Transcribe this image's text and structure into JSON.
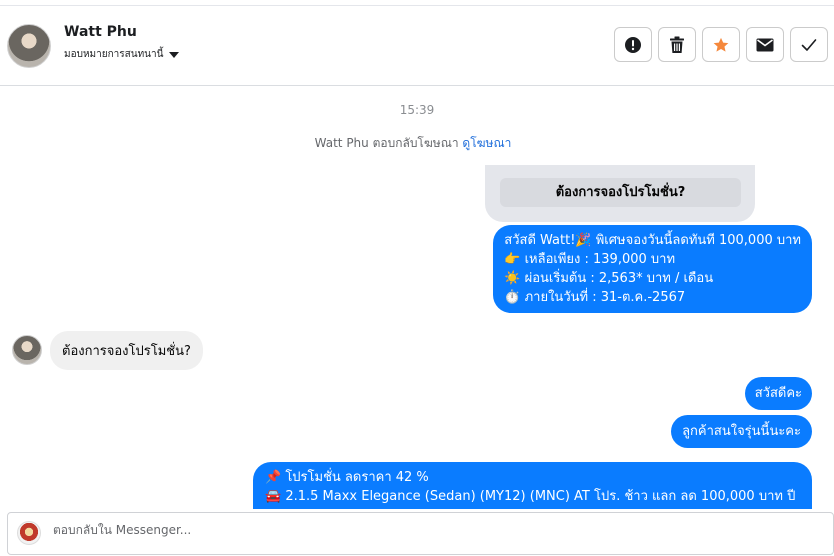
{
  "header": {
    "contact_name": "Watt Phu",
    "assign_label": "มอบหมายการสนทนานี้",
    "actions": [
      {
        "icon": "exclamation-icon",
        "color": "#1c1e21"
      },
      {
        "icon": "trash-icon",
        "color": "#1c1e21"
      },
      {
        "icon": "star-icon",
        "color": "#f5883c"
      },
      {
        "icon": "envelope-icon",
        "color": "#1c1e21"
      },
      {
        "icon": "checkmark-icon",
        "color": "#1c1e21"
      }
    ]
  },
  "conversation": {
    "timestamp": "15:39",
    "reply_note": "Watt Phu ตอบกลับโฆษณา",
    "view_ad_link": "ดูโฆษณา",
    "ad_button_label": "ต้องการจองโปรโมชั่น?",
    "greeting_lines": [
      "สวัสดี Watt!🎉 พิเศษจองวันนี้ลดทันที 100,000 บาท",
      "👉 เหลือเพียง : 139,000 บาท",
      "☀️ ผ่อนเริ่มต้น : 2,563* บาท / เดือน",
      "⏱️ ภายในวันที่ : 31-ต.ค.-2567"
    ],
    "customer_message": "ต้องการจองโปรโมชั่น?",
    "reply_hello": "สวัสดีคะ",
    "reply_interest": "ลูกค้าสนใจรุ่นนี้นะคะ",
    "promo_lines": [
      "📌 โปรโมชั่น ลดราคา 42 %",
      "🚘 2.1.5 Maxx Elegance (Sedan) (MY12) (MNC) AT โปร. ช้าว แลก ลด 100,000 บาท ปี"
    ]
  },
  "composer": {
    "placeholder": "ตอบกลับใน Messenger..."
  },
  "colors": {
    "accent_blue": "#0a7cff",
    "incoming_bubble": "#f0f0f0",
    "link": "#216fdb",
    "star": "#f5883c"
  }
}
